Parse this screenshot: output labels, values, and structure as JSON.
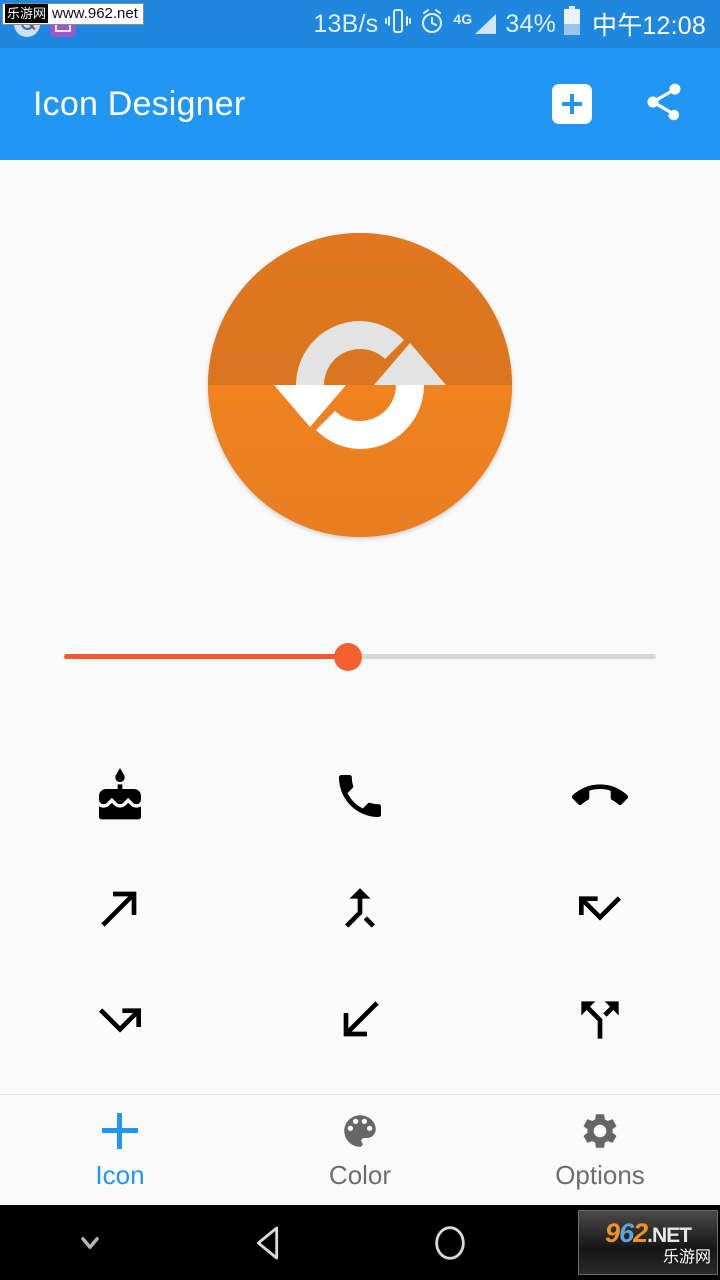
{
  "statusbar": {
    "notifications": [
      {
        "icon": "search-icon"
      },
      {
        "icon": "scan-icon"
      }
    ],
    "network_speed": "13B/s",
    "vibrate_icon": "vibrate-icon",
    "alarm_icon": "alarm-icon",
    "signal_label": "4G",
    "battery_percent": "34%",
    "battery_icon": "battery-icon",
    "time": "中午12:08",
    "bg_color": "#1f87de"
  },
  "watermark": {
    "top_cn": "乐游网",
    "top_url": "www.962.net",
    "nav_num_9": "9",
    "nav_num_6": "6",
    "nav_num_2": "2",
    "nav_net": ".NET",
    "nav_cn": "乐游网"
  },
  "appbar": {
    "title": "Icon Designer",
    "bg_color": "#2196f3",
    "actions": [
      {
        "name": "add-icon-button",
        "icon": "plus-square-icon"
      },
      {
        "name": "share-button",
        "icon": "share-icon"
      }
    ]
  },
  "preview": {
    "icon_name": "sync-icon",
    "shape": "circle",
    "top_half_color": "#d9761f",
    "bottom_half_color": "#f0831f",
    "glyph_top_color": "#e3e3e3",
    "glyph_bottom_color": "#ffffff"
  },
  "slider": {
    "name": "icon-size-slider",
    "value_percent": 48,
    "fill_color": "#f4582e",
    "track_color": "#d6d6d6",
    "thumb_color": "#f4602f"
  },
  "icon_grid": {
    "rows": [
      [
        {
          "name": "cake-icon",
          "label": "cake"
        },
        {
          "name": "call-icon",
          "label": "call"
        },
        {
          "name": "call-end-icon",
          "label": "call-end"
        }
      ],
      [
        {
          "name": "call-made-icon",
          "label": "call-made"
        },
        {
          "name": "call-merge-icon",
          "label": "call-merge"
        },
        {
          "name": "call-missed-icon",
          "label": "call-missed"
        }
      ],
      [
        {
          "name": "call-missed-outgoing-icon",
          "label": "call-missed-outgoing"
        },
        {
          "name": "call-received-icon",
          "label": "call-received"
        },
        {
          "name": "call-split-icon",
          "label": "call-split"
        }
      ]
    ],
    "icon_color": "#000000"
  },
  "bottomnav": {
    "active_color": "#2196f3",
    "inactive_color": "#6d6d6d",
    "items": [
      {
        "label": "Icon",
        "icon": "plus-icon",
        "active": true
      },
      {
        "label": "Color",
        "icon": "palette-icon",
        "active": false
      },
      {
        "label": "Options",
        "icon": "gear-icon",
        "active": false
      }
    ]
  },
  "navbar": {
    "buttons": [
      {
        "name": "hide-keyboard-button",
        "icon": "chevron-down-icon"
      },
      {
        "name": "back-button",
        "icon": "triangle-left-icon"
      },
      {
        "name": "home-button",
        "icon": "circle-icon"
      },
      {
        "name": "recents-button",
        "icon": "square-icon"
      }
    ]
  }
}
